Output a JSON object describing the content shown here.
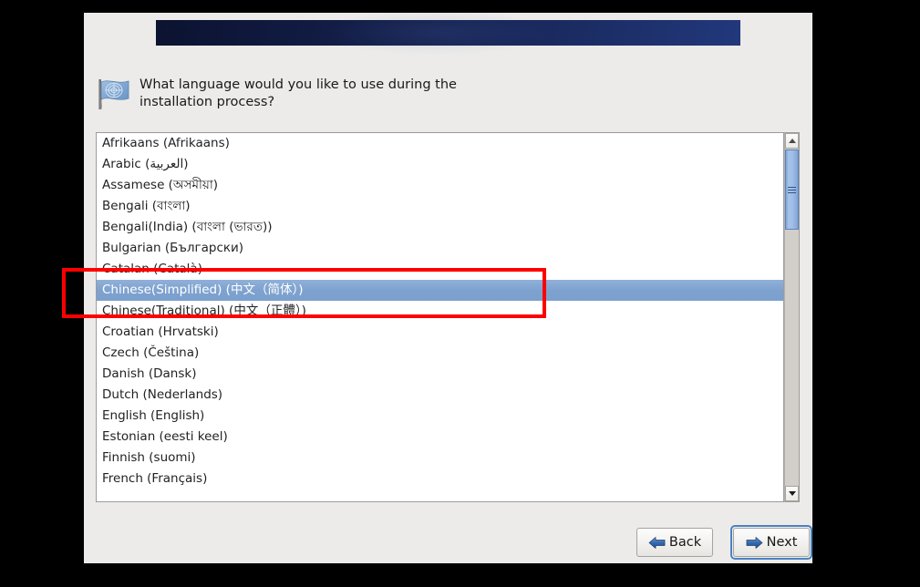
{
  "window": {
    "banner_title": "",
    "prompt": "What language would you like to use during the installation process?",
    "flag_icon": "un-flag-icon"
  },
  "language_list": {
    "selected_index": 7,
    "items": [
      "Afrikaans (Afrikaans)",
      "Arabic (العربية)",
      "Assamese (অসমীয়া)",
      "Bengali (বাংলা)",
      "Bengali(India) (বাংলা (ভারত))",
      "Bulgarian (Български)",
      "Catalan (Català)",
      "Chinese(Simplified) (中文（简体）)",
      "Chinese(Traditional) (中文（正體）)",
      "Croatian (Hrvatski)",
      "Czech (Čeština)",
      "Danish (Dansk)",
      "Dutch (Nederlands)",
      "English (English)",
      "Estonian (eesti keel)",
      "Finnish (suomi)",
      "French (Français)"
    ]
  },
  "scrollbar": {
    "up_arrow_icon": "chevron-up-icon",
    "down_arrow_icon": "chevron-down-icon",
    "grip_icon": "grip-lines-icon"
  },
  "footer": {
    "back_label": "Back",
    "back_icon": "arrow-left-icon",
    "next_label": "Next",
    "next_icon": "arrow-right-icon",
    "focused_button": "Next"
  },
  "annotation": {
    "color": "#fe0000",
    "shape": "rectangle"
  },
  "colors": {
    "window_bg": "#ecebe9",
    "banner_start": "#0b1330",
    "banner_end": "#22387c",
    "selection": "#7ea2cf",
    "accent": "#4a82c4",
    "annotation": "#fe0000"
  }
}
